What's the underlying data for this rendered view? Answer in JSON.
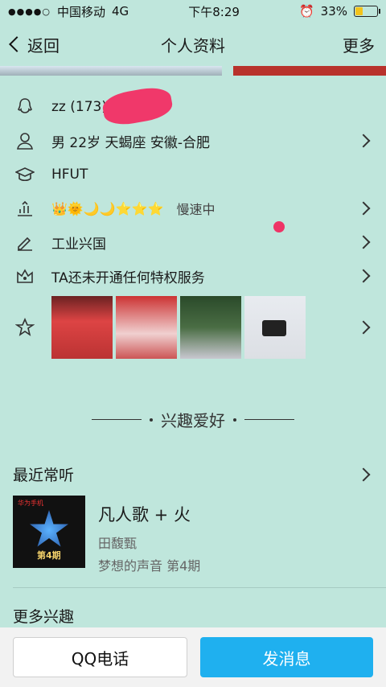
{
  "status_bar": {
    "carrier": "中国移动",
    "network": "4G",
    "time": "下午8:29",
    "battery_percent": "33%",
    "battery_level": 0.33
  },
  "nav": {
    "back_label": "返回",
    "title": "个人资料",
    "more_label": "更多"
  },
  "profile": {
    "name": "zz (173",
    "name_tail": ")",
    "basic_info": "男  22岁  天蝎座  安徽-合肥",
    "school": "HFUT",
    "level_icons": "👑🌞🌙🌙⭐⭐⭐",
    "level_status": "慢速中",
    "signature": "工业兴国",
    "privilege": "TA还未开通任何特权服务"
  },
  "icons": {
    "qq": "qq-penguin-icon",
    "person": "person-icon",
    "school": "graduation-cap-icon",
    "level": "level-chart-icon",
    "pen": "pencil-icon",
    "crown": "crown-icon",
    "star": "star-icon"
  },
  "hobby": {
    "section_title": "兴趣爱好",
    "recent_listen": "最近常听",
    "song_title": "凡人歌 + 火",
    "artist": "田馥甄",
    "album": "梦想的声音 第4期",
    "cover_brand": "华为手机",
    "cover_episode": "第4期",
    "more_hobbies": "更多兴趣"
  },
  "actions": {
    "call": "QQ电话",
    "message": "发消息"
  },
  "colors": {
    "background": "#bfe6dc",
    "accent": "#1fb0ef",
    "mark": "#ee3466"
  }
}
